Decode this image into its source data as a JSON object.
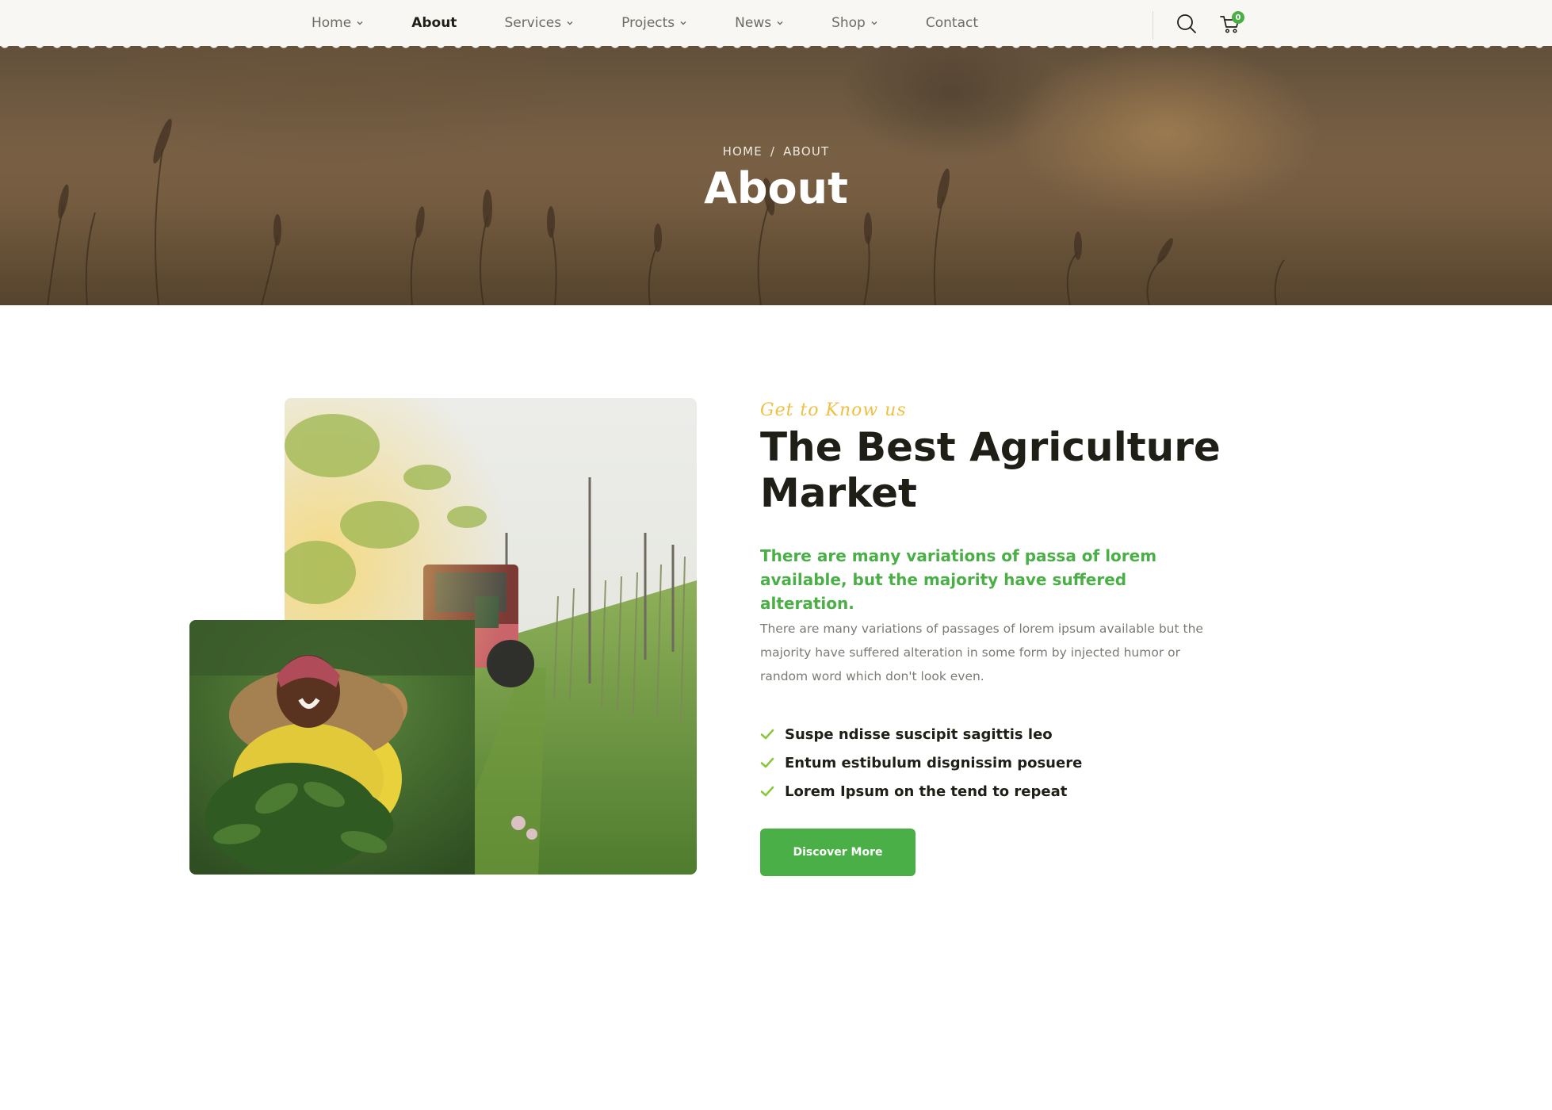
{
  "nav": {
    "items": [
      {
        "label": "Home",
        "dropdown": true,
        "active": false
      },
      {
        "label": "About",
        "dropdown": false,
        "active": true
      },
      {
        "label": "Services",
        "dropdown": true,
        "active": false
      },
      {
        "label": "Projects",
        "dropdown": true,
        "active": false
      },
      {
        "label": "News",
        "dropdown": true,
        "active": false
      },
      {
        "label": "Shop",
        "dropdown": true,
        "active": false
      },
      {
        "label": "Contact",
        "dropdown": false,
        "active": false
      }
    ],
    "cart_count": "0",
    "icons": {
      "search": "search-icon",
      "cart": "cart-icon"
    }
  },
  "hero": {
    "breadcrumb": {
      "home": "HOME",
      "separator": "/",
      "current": "ABOUT"
    },
    "title": "About"
  },
  "about": {
    "tagline": "Get to Know us",
    "title": "The Best Agriculture Market",
    "lead": "There are many variations of passa of lorem available, but the majority have suffered alteration.",
    "body": "There are many variations of passages of lorem ipsum available but the majority have suffered alteration in some form by injected humor or random word which don't look even.",
    "checklist": [
      "Suspe ndisse suscipit sagittis leo",
      "Entum estibulum disgnissim posuere",
      "Lorem Ipsum on the tend to repeat"
    ],
    "cta_label": "Discover More"
  },
  "colors": {
    "accent_green": "#4baf47",
    "tagline_yellow": "#eec044",
    "dark_text": "#1f1e17",
    "muted_text": "#7b7b75",
    "nav_bg": "#f8f7f3"
  }
}
